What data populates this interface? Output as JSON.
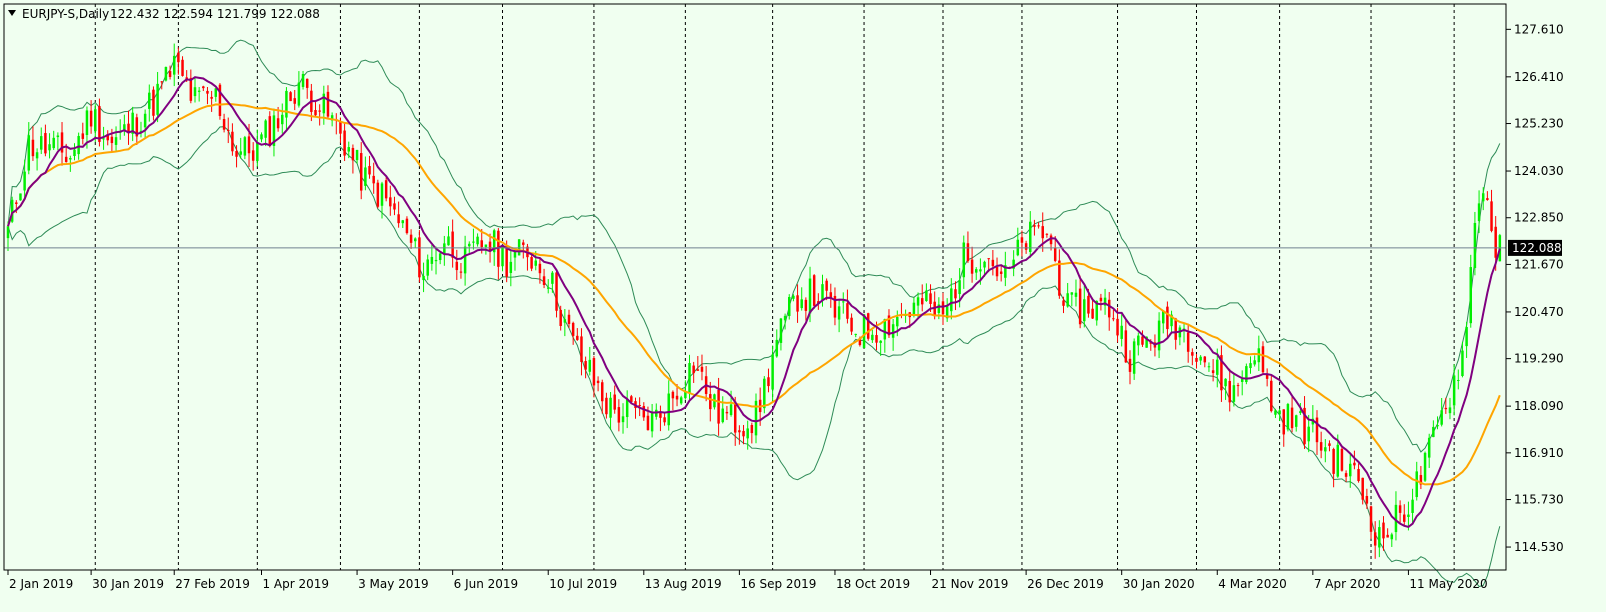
{
  "header": {
    "symbol": "EURJPY-S,Daily",
    "ohlc": "122.432 122.594 121.799 122.088"
  },
  "colors": {
    "background": "#f0fff0",
    "frame": "#000000",
    "up_candle": "#00ee00",
    "down_candle": "#ff0000",
    "bands": "#2e8b57",
    "ma_fast": "#800080",
    "ma_slow": "#ffa500",
    "period_separator": "#000000",
    "price_line": "#708090",
    "price_tag_bg": "#000000",
    "price_tag_text": "#ffffff"
  },
  "chart_data": {
    "type": "candlestick",
    "instrument": "EURJPY-S",
    "timeframe": "Daily",
    "current_price": 122.088,
    "current_price_label": "122.088",
    "ylim": [
      113.95,
      128.25
    ],
    "y_ticks": [
      127.61,
      126.41,
      125.23,
      124.03,
      122.85,
      121.67,
      120.47,
      119.29,
      118.09,
      116.91,
      115.73,
      114.53
    ],
    "y_tick_labels": [
      "127.610",
      "126.410",
      "125.230",
      "124.030",
      "122.850",
      "121.670",
      "120.470",
      "119.290",
      "118.090",
      "116.910",
      "115.730",
      "114.530"
    ],
    "x_labels": [
      "2 Jan 2019",
      "30 Jan 2019",
      "27 Feb 2019",
      "1 Apr 2019",
      "3 May 2019",
      "6 Jun 2019",
      "10 Jul 2019",
      "13 Aug 2019",
      "16 Sep 2019",
      "18 Oct 2019",
      "21 Nov 2019",
      "26 Dec 2019",
      "30 Jan 2020",
      "4 Mar 2020",
      "7 Apr 2020",
      "11 May 2020"
    ],
    "x_label_index": [
      0,
      20,
      40,
      61,
      84,
      107,
      130,
      153,
      176,
      199,
      222,
      245,
      268,
      291,
      314,
      337
    ],
    "separator_index": [
      21,
      41,
      60,
      80,
      99,
      119,
      141,
      163,
      184,
      206,
      225,
      244,
      267,
      286,
      306,
      328,
      348
    ],
    "guide_points": [
      [
        0,
        122.5
      ],
      [
        5,
        124.7
      ],
      [
        10,
        124.6
      ],
      [
        15,
        124.4
      ],
      [
        20,
        125.5
      ],
      [
        25,
        124.7
      ],
      [
        30,
        125.2
      ],
      [
        35,
        125.8
      ],
      [
        40,
        126.7
      ],
      [
        45,
        125.8
      ],
      [
        50,
        125.9
      ],
      [
        55,
        124.5
      ],
      [
        60,
        124.6
      ],
      [
        65,
        125.4
      ],
      [
        70,
        126.3
      ],
      [
        75,
        125.7
      ],
      [
        80,
        125.0
      ],
      [
        85,
        123.9
      ],
      [
        90,
        123.4
      ],
      [
        95,
        122.6
      ],
      [
        100,
        121.5
      ],
      [
        105,
        122.3
      ],
      [
        110,
        121.7
      ],
      [
        115,
        122.3
      ],
      [
        120,
        121.8
      ],
      [
        125,
        122.0
      ],
      [
        130,
        121.4
      ],
      [
        135,
        119.9
      ],
      [
        140,
        118.9
      ],
      [
        145,
        118.0
      ],
      [
        150,
        117.9
      ],
      [
        155,
        117.7
      ],
      [
        160,
        118.3
      ],
      [
        165,
        119.2
      ],
      [
        170,
        118.0
      ],
      [
        175,
        117.7
      ],
      [
        180,
        117.8
      ],
      [
        185,
        119.7
      ],
      [
        190,
        120.9
      ],
      [
        195,
        120.9
      ],
      [
        200,
        120.4
      ],
      [
        205,
        120.0
      ],
      [
        210,
        120.1
      ],
      [
        215,
        120.4
      ],
      [
        220,
        120.7
      ],
      [
        225,
        120.3
      ],
      [
        230,
        121.8
      ],
      [
        235,
        122.0
      ],
      [
        240,
        121.3
      ],
      [
        245,
        122.3
      ],
      [
        250,
        122.5
      ],
      [
        255,
        120.5
      ],
      [
        260,
        120.6
      ],
      [
        265,
        120.6
      ],
      [
        270,
        119.4
      ],
      [
        275,
        119.8
      ],
      [
        280,
        120.3
      ],
      [
        285,
        119.8
      ],
      [
        290,
        119.0
      ],
      [
        295,
        118.4
      ],
      [
        300,
        119.6
      ],
      [
        305,
        117.9
      ],
      [
        310,
        117.7
      ],
      [
        315,
        117.3
      ],
      [
        320,
        116.7
      ],
      [
        325,
        116.2
      ],
      [
        330,
        114.7
      ],
      [
        335,
        115.3
      ],
      [
        340,
        116.3
      ],
      [
        345,
        117.8
      ],
      [
        350,
        119.4
      ],
      [
        353,
        122.6
      ],
      [
        355,
        123.8
      ],
      [
        358,
        122.1
      ]
    ],
    "indicators": [
      "Bollinger Bands",
      "Moving Average (fast)",
      "Moving Average (slow)"
    ]
  }
}
